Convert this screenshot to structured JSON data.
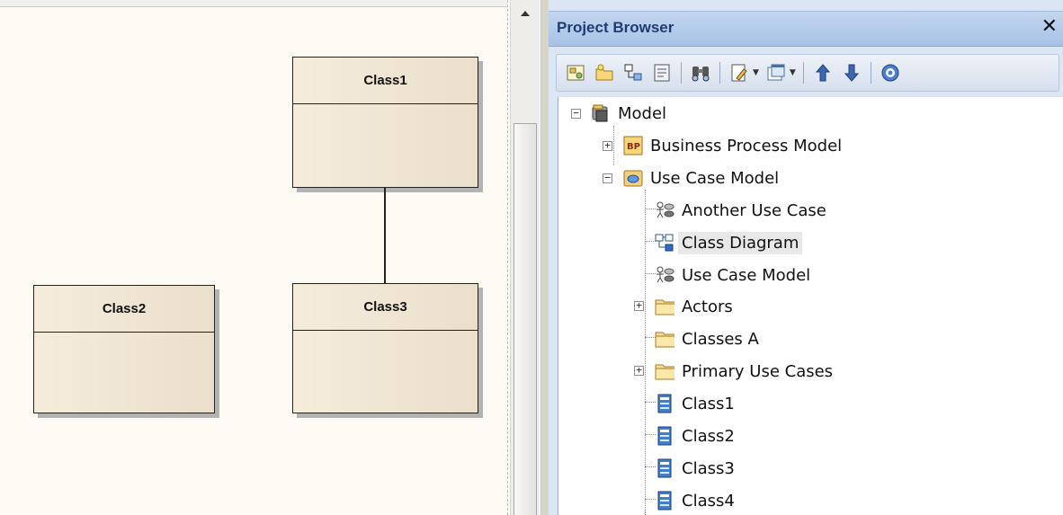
{
  "diagram": {
    "classes": [
      {
        "name": "Class1"
      },
      {
        "name": "Class2"
      },
      {
        "name": "Class3"
      }
    ]
  },
  "browser": {
    "title": "Project Browser",
    "close_glyph": "✕",
    "toolbar": [
      "new-diagram-icon",
      "new-package-icon",
      "new-element-icon",
      "package-properties-icon",
      "find-icon",
      "edit-icon",
      "window-icon",
      "move-up-icon",
      "move-down-icon",
      "help-icon"
    ],
    "tree": [
      {
        "label": "Model",
        "icon": "model-root-icon"
      },
      {
        "label": "Business Process Model",
        "icon": "business-process-icon"
      },
      {
        "label": "Use Case Model",
        "icon": "use-case-package-icon"
      },
      {
        "label": "Another Use Case",
        "icon": "use-case-diagram-icon"
      },
      {
        "label": "Class Diagram",
        "icon": "class-diagram-icon"
      },
      {
        "label": "Use Case Model",
        "icon": "use-case-diagram-icon"
      },
      {
        "label": "Actors",
        "icon": "folder-icon"
      },
      {
        "label": "Classes A",
        "icon": "folder-icon"
      },
      {
        "label": "Primary Use Cases",
        "icon": "folder-icon"
      },
      {
        "label": "Class1",
        "icon": "class-element-icon"
      },
      {
        "label": "Class2",
        "icon": "class-element-icon"
      },
      {
        "label": "Class3",
        "icon": "class-element-icon"
      },
      {
        "label": "Class4",
        "icon": "class-element-icon"
      }
    ]
  }
}
